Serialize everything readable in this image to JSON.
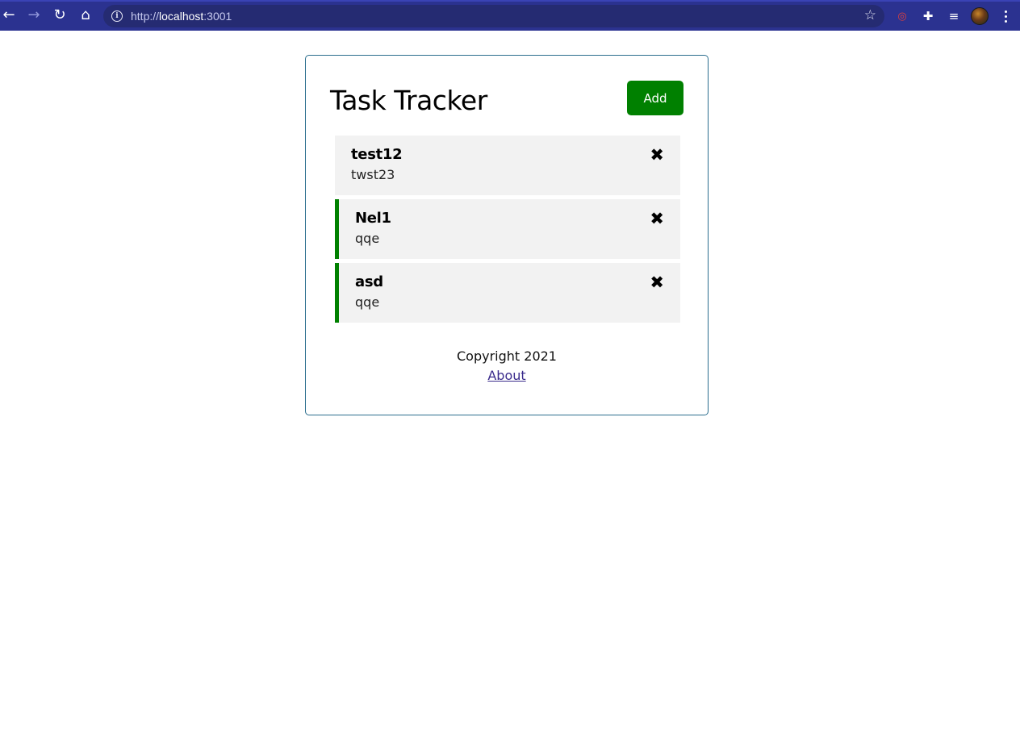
{
  "browser": {
    "url_scheme": "http://",
    "url_host": "localhost",
    "url_port": ":3001",
    "icons": {
      "back": "←",
      "forward": "→",
      "reload": "↻",
      "home": "⌂",
      "star": "☆",
      "extension_red": "◎",
      "puzzle": "✚",
      "media": "≡"
    }
  },
  "app": {
    "title": "Task Tracker",
    "add_label": "Add",
    "tasks": [
      {
        "text": "test12",
        "day": "twst23",
        "reminder": false
      },
      {
        "text": "Nel1",
        "day": "qqe",
        "reminder": true
      },
      {
        "text": "asd",
        "day": "qqe",
        "reminder": true
      }
    ],
    "delete_glyph": "✖",
    "footer": {
      "copyright": "Copyright 2021",
      "about_label": "About"
    }
  },
  "colors": {
    "accent": "#008000",
    "chrome": "#2b3290",
    "border": "#2c6e8e"
  }
}
